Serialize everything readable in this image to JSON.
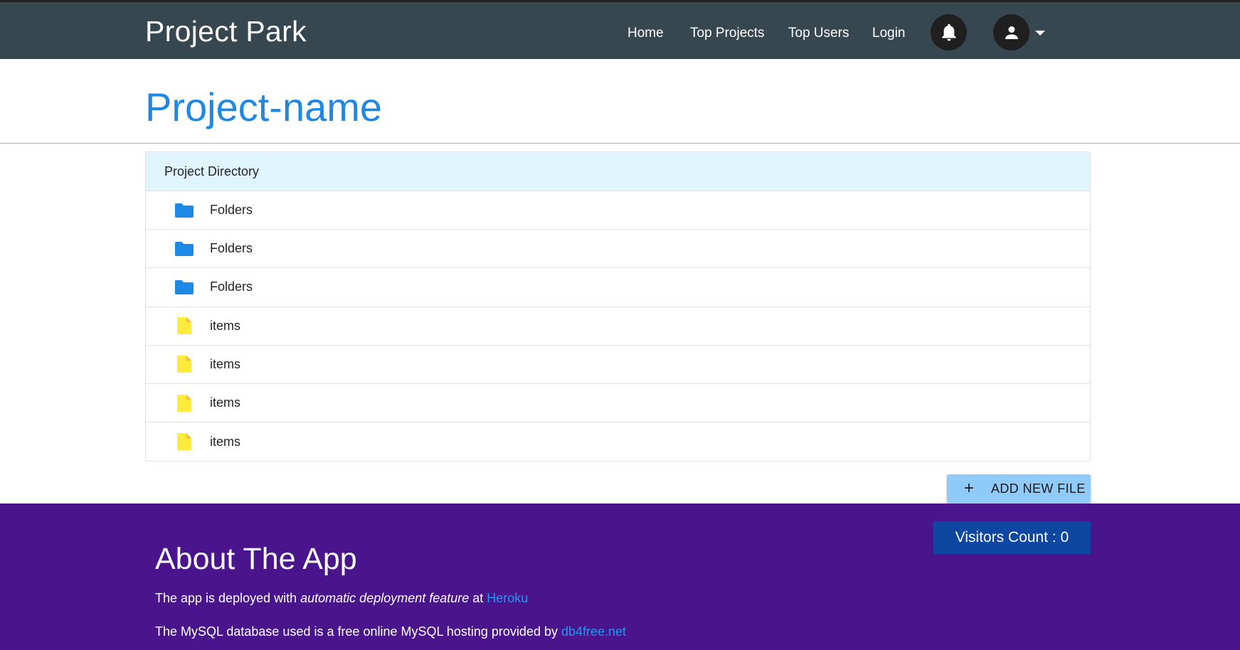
{
  "navbar": {
    "brand": "Project Park",
    "links": [
      "Home",
      "Top Projects",
      "Top Users",
      "Login"
    ],
    "bell_icon": "bell-icon",
    "account_icon": "account-icon",
    "caret_icon": "caret-down-icon",
    "background": "#37474f"
  },
  "project": {
    "title": "Project-name",
    "title_color": "#1e88e5"
  },
  "directory": {
    "header": "Project Directory",
    "header_background": "#e1f5fe",
    "rows": [
      {
        "label": "Folders",
        "icon": "folder-icon",
        "icon_color": "#1e88e5"
      },
      {
        "label": "Folders",
        "icon": "folder-icon",
        "icon_color": "#1e88e5"
      },
      {
        "label": "Folders",
        "icon": "folder-icon",
        "icon_color": "#1e88e5"
      },
      {
        "label": "items",
        "icon": "file-icon",
        "icon_color": "#ffeb3b"
      },
      {
        "label": "items",
        "icon": "file-icon",
        "icon_color": "#ffeb3b"
      },
      {
        "label": "items",
        "icon": "file-icon",
        "icon_color": "#ffeb3b"
      },
      {
        "label": "items",
        "icon": "file-icon",
        "icon_color": "#ffeb3b"
      }
    ]
  },
  "add_file_button": {
    "icon": "plus-icon",
    "label": "ADD NEW FILE",
    "background": "#90caf9"
  },
  "footer": {
    "background": "#4a148c",
    "visitors_label": "Visitors Count : 0",
    "visitors_background": "#0d47a1",
    "about_title": "About The App",
    "line1": {
      "prefix": "The app is deployed with ",
      "emphasis": "automatic deployment feature",
      "middle": " at ",
      "link": "Heroku"
    },
    "line2": {
      "prefix": "The MySQL database used is a free online MySQL hosting provided by ",
      "link": "db4free.net"
    },
    "link_color": "#2196f3"
  }
}
